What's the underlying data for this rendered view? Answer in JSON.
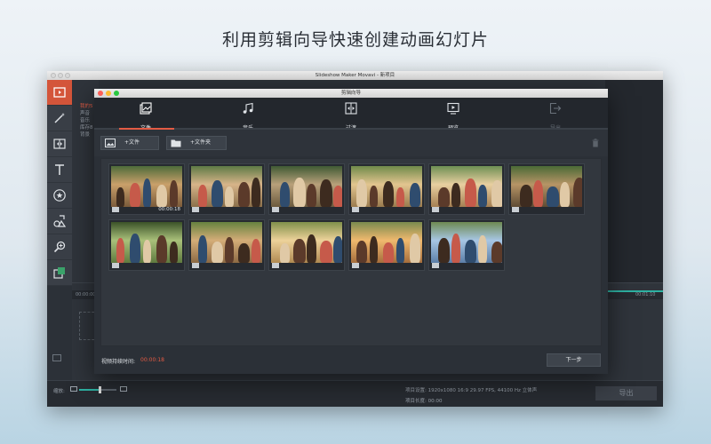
{
  "headline": "利用剪辑向导快速创建动画幻灯片",
  "app": {
    "title": "Slideshow Maker Movavi - 新项目",
    "side_panel": [
      "我的5",
      "声音",
      "音乐",
      "库存8",
      "背景"
    ],
    "ruler_start": "00:00:00",
    "ruler_end": "00:01:10",
    "zoom_label": "缩放:",
    "zoom_level": 0.55,
    "project_settings": "项目设置:  1920x1080 16:9 29.97 FPS, 44100 Hz 立体声",
    "project_length": "项目长度:  00:00",
    "export_label": "导出"
  },
  "wizard": {
    "title": "剪辑向导",
    "tabs": [
      {
        "label": "文件",
        "icon": "files-icon",
        "active": true
      },
      {
        "label": "音乐",
        "icon": "music-icon",
        "active": false
      },
      {
        "label": "过渡",
        "icon": "transition-icon",
        "active": false
      },
      {
        "label": "预览",
        "icon": "preview-icon",
        "active": false
      },
      {
        "label": "导出",
        "icon": "export-icon",
        "active": false,
        "disabled": true
      }
    ],
    "add_files_label": "+文件",
    "add_folder_label": "+文件夹",
    "thumbnails": [
      {
        "type": "video",
        "duration": "00:00:18"
      },
      {
        "type": "image"
      },
      {
        "type": "image"
      },
      {
        "type": "image"
      },
      {
        "type": "image"
      },
      {
        "type": "image"
      },
      {
        "type": "image"
      },
      {
        "type": "image"
      },
      {
        "type": "image"
      },
      {
        "type": "image"
      },
      {
        "type": "image"
      }
    ],
    "duration_label": "视频持续时间:",
    "duration_value": "00:00:18",
    "next_label": "下一步"
  },
  "colors": {
    "accent": "#e35b44",
    "teal": "#2eb1a2",
    "window_bg": "#2b3037"
  }
}
